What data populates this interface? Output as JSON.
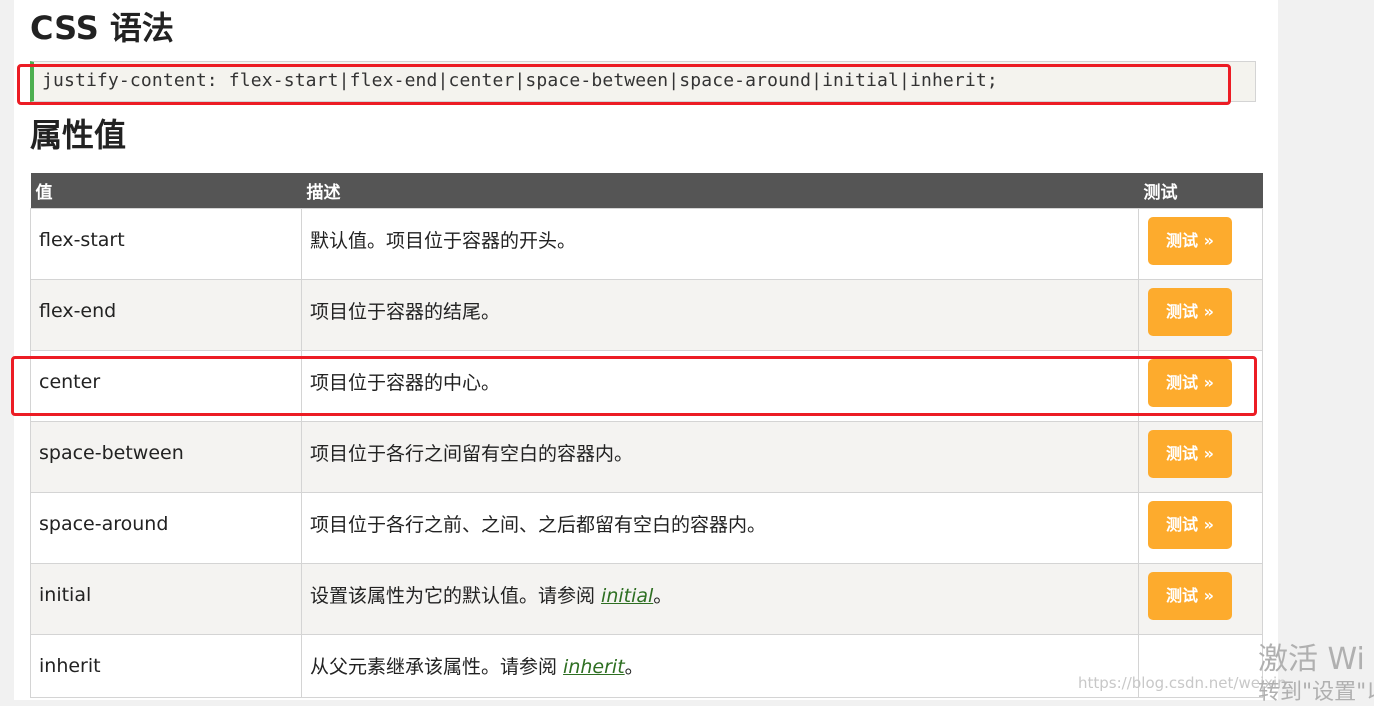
{
  "syntax": {
    "heading": "CSS 语法",
    "code": "justify-content: flex-start|flex-end|center|space-between|space-around|initial|inherit;"
  },
  "values": {
    "heading": "属性值",
    "columns": [
      "值",
      "描述",
      "测试"
    ],
    "test_label": "测试 »",
    "rows": [
      {
        "value": "flex-start",
        "description": "默认值。项目位于容器的开头。"
      },
      {
        "value": "flex-end",
        "description": "项目位于容器的结尾。"
      },
      {
        "value": "center",
        "description": "项目位于容器的中心。"
      },
      {
        "value": "space-between",
        "description": "项目位于各行之间留有空白的容器内。"
      },
      {
        "value": "space-around",
        "description": "项目位于各行之前、之间、之后都留有空白的容器内。"
      },
      {
        "value": "initial",
        "description_before": "设置该属性为它的默认值。请参阅 ",
        "link": "initial",
        "description_after": "。"
      },
      {
        "value": "inherit",
        "description_before": "从父元素继承该属性。请参阅 ",
        "link": "inherit",
        "description_after": "。"
      }
    ]
  },
  "watermark": {
    "activate": "激活 Wi",
    "settings": "转到\"设置\"以",
    "url": "https://blog.csdn.net/weixin_"
  },
  "colors": {
    "header_bg": "#555555",
    "button": "#fdab2d",
    "highlight": "#ec1c24",
    "link": "#2e6f22"
  }
}
